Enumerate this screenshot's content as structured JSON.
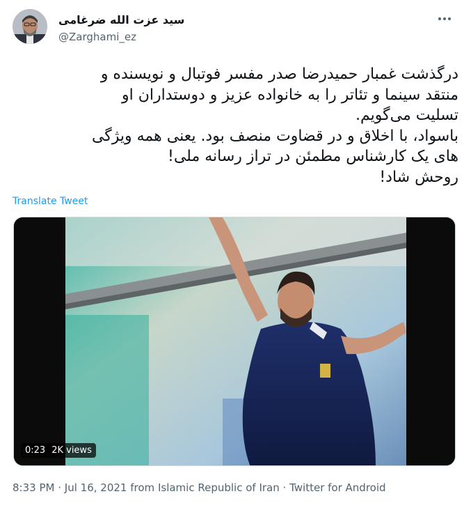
{
  "author": {
    "display_name": "سید عزت الله ضرغامی",
    "handle": "@Zarghami_ez",
    "avatar_icon": "avatar-photo"
  },
  "tweet": {
    "text_lines": [
      "درگذشت غمبار حمیدرضا صدر مفسر فوتبال و نویسنده و",
      "منتقد سینما و تئاتر را به خانواده عزیز و دوستداران او",
      "تسلیت می‌گویم.",
      "باسواد، با اخلاق و در قضاوت منصف بود. یعنی همه ویژگی",
      "های یک کارشناس مطمئن در تراز رسانه ملی!",
      "روحش شاد!"
    ],
    "translate_label": "Translate Tweet"
  },
  "video": {
    "duration": "0:23",
    "views": "2K views"
  },
  "meta": {
    "time": "8:33 PM",
    "date": "Jul 16, 2021",
    "from_prefix": "from",
    "location": "Islamic Republic of Iran",
    "separator": "·",
    "client": "Twitter for Android"
  },
  "colors": {
    "link": "#1d9bf0",
    "secondary_text": "#536471",
    "primary_text": "#0f1419"
  }
}
